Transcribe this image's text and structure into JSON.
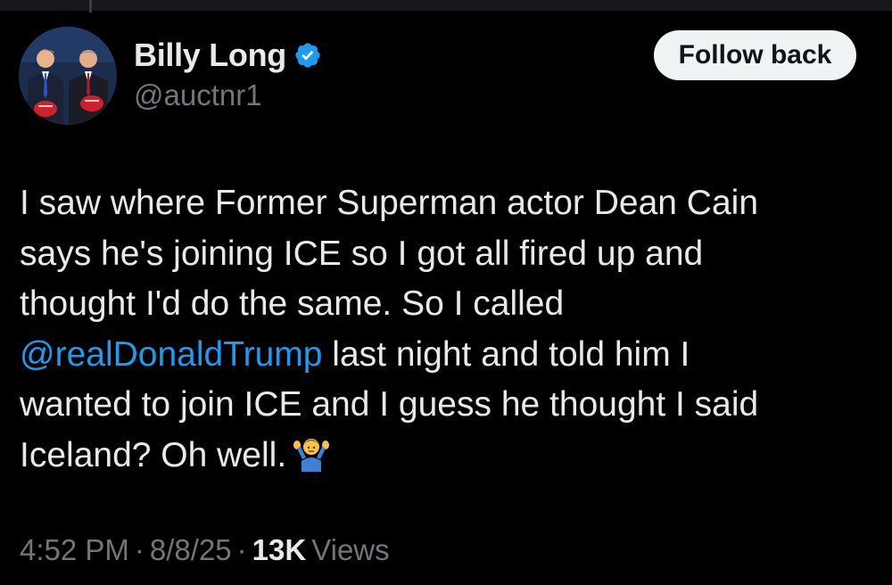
{
  "author": {
    "display_name": "Billy Long",
    "handle": "@auctnr1",
    "verified": true,
    "verified_icon": "verified-badge-icon",
    "verified_color": "#1d9bf0"
  },
  "follow_button": {
    "label": "Follow back"
  },
  "tweet": {
    "lines": [
      "I saw where Former Superman actor Dean Cain",
      "says he's joining ICE so I got all fired up and",
      "thought I'd do the same. So I called"
    ],
    "mention": "@realDonaldTrump",
    "mention_line_rest": " last night and told him I",
    "line_5": "wanted to join ICE and I guess he thought I said",
    "line_6": "Iceland? Oh well.",
    "emoji": "person-shrugging-emoji"
  },
  "meta": {
    "time": "4:52 PM",
    "date": "8/8/25",
    "separator": "·",
    "views_count": "13K",
    "views_label": "Views"
  },
  "colors": {
    "background": "#000000",
    "text": "#e7e9ea",
    "secondary": "#71767b",
    "link": "#1d9bf0",
    "button_bg": "#eff3f4"
  }
}
